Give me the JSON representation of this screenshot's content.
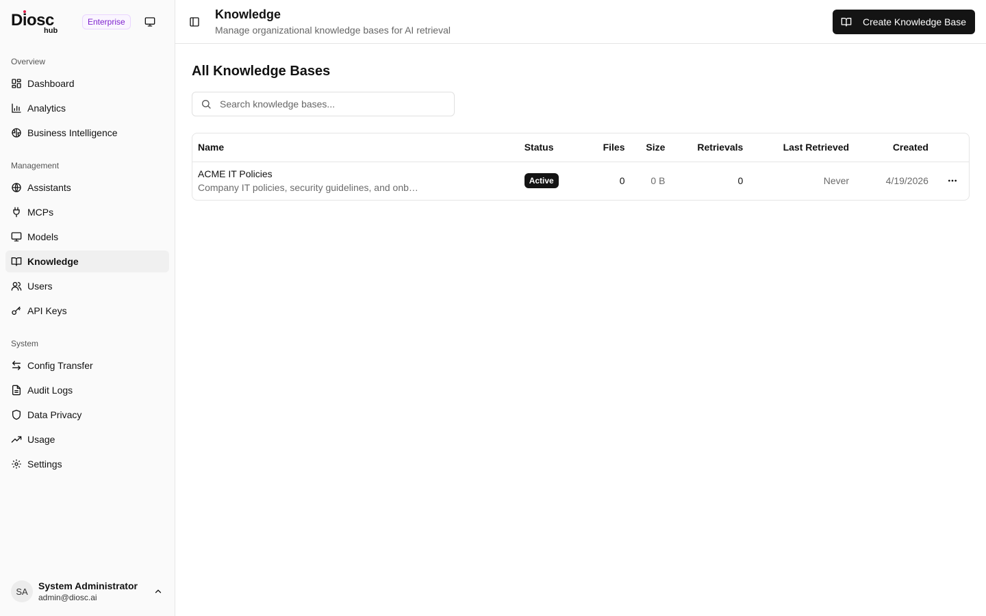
{
  "brand": {
    "logo_text": "Diosc",
    "logo_sub": "hub",
    "edition_badge": "Enterprise"
  },
  "sidebar": {
    "sections": [
      {
        "label": "Overview",
        "items": [
          {
            "label": "Dashboard",
            "icon": "dashboard-icon"
          },
          {
            "label": "Analytics",
            "icon": "bar-chart-icon"
          },
          {
            "label": "Business Intelligence",
            "icon": "brain-icon"
          }
        ]
      },
      {
        "label": "Management",
        "items": [
          {
            "label": "Assistants",
            "icon": "globe-icon"
          },
          {
            "label": "MCPs",
            "icon": "plug-icon"
          },
          {
            "label": "Models",
            "icon": "monitor-icon"
          },
          {
            "label": "Knowledge",
            "icon": "book-open-icon",
            "active": true
          },
          {
            "label": "Users",
            "icon": "users-icon"
          },
          {
            "label": "API Keys",
            "icon": "key-icon"
          }
        ]
      },
      {
        "label": "System",
        "items": [
          {
            "label": "Config Transfer",
            "icon": "arrows-transfer-icon"
          },
          {
            "label": "Audit Logs",
            "icon": "file-text-icon"
          },
          {
            "label": "Data Privacy",
            "icon": "shield-icon"
          },
          {
            "label": "Usage",
            "icon": "trending-up-icon"
          },
          {
            "label": "Settings",
            "icon": "gear-icon"
          }
        ]
      }
    ]
  },
  "user": {
    "initials": "SA",
    "name": "System Administrator",
    "email": "admin@diosc.ai"
  },
  "header": {
    "title": "Knowledge",
    "subtitle": "Manage organizational knowledge bases for AI retrieval",
    "create_label": "Create Knowledge Base"
  },
  "main": {
    "heading": "All Knowledge Bases",
    "search_placeholder": "Search knowledge bases...",
    "table": {
      "columns": [
        "Name",
        "Status",
        "Files",
        "Size",
        "Retrievals",
        "Last Retrieved",
        "Created"
      ],
      "rows": [
        {
          "name": "ACME IT Policies",
          "description": "Company IT policies, security guidelines, and onb…",
          "status": "Active",
          "files": "0",
          "size": "0 B",
          "retrievals": "0",
          "last_retrieved": "Never",
          "created": "4/19/2026"
        }
      ]
    }
  },
  "colors": {
    "primary": "#141414",
    "accent_purple": "#7e22ce",
    "logo_dot": "#e11d48"
  }
}
